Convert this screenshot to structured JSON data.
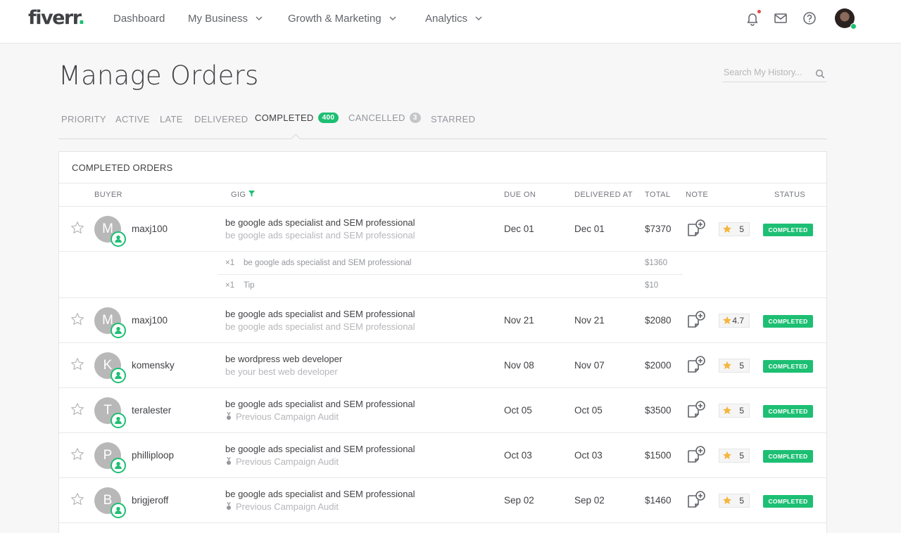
{
  "header": {
    "logo": "fiverr",
    "logo_dot": ".",
    "nav": [
      {
        "label": "Dashboard",
        "has_chevron": false
      },
      {
        "label": "My Business",
        "has_chevron": true
      },
      {
        "label": "Growth & Marketing",
        "has_chevron": true
      },
      {
        "label": "Analytics",
        "has_chevron": true
      }
    ],
    "icons": [
      "bell-icon",
      "envelope-icon",
      "help-icon"
    ],
    "notification_dot_color": "#e34d4d"
  },
  "page": {
    "title": "Manage Orders",
    "search_placeholder": "Search My History..."
  },
  "tabs": [
    {
      "label": "PRIORITY"
    },
    {
      "label": "ACTIVE"
    },
    {
      "label": "LATE"
    },
    {
      "label": "DELIVERED"
    },
    {
      "label": "COMPLETED",
      "badge": "400",
      "active": true
    },
    {
      "label": "CANCELLED",
      "badge": "3"
    },
    {
      "label": "STARRED"
    }
  ],
  "table": {
    "title": "COMPLETED ORDERS",
    "columns": {
      "buyer": "BUYER",
      "gig": "GIG",
      "due_on": "DUE ON",
      "delivered_at": "DELIVERED AT",
      "total": "TOTAL",
      "note": "NOTE",
      "status": "STATUS"
    },
    "rows": [
      {
        "initial": "M",
        "buyer": "maxj100",
        "gig": "be google ads specialist and SEM professional",
        "gig_sub": "be google ads specialist and SEM professional",
        "due": "Dec 01",
        "delivered": "Dec 01",
        "total": "$7370",
        "rating": "5",
        "status": "COMPLETED"
      },
      {
        "initial": "M",
        "buyer": "maxj100",
        "gig": "be google ads specialist and SEM professional",
        "gig_sub": "be google ads specialist and SEM professional",
        "due": "Nov 21",
        "delivered": "Nov 21",
        "total": "$2080",
        "rating": "4.7",
        "status": "COMPLETED"
      },
      {
        "initial": "K",
        "buyer": "komensky",
        "gig": "be wordpress web developer",
        "gig_sub": "be your best web developer",
        "due": "Nov 08",
        "delivered": "Nov 07",
        "total": "$2000",
        "rating": "5",
        "status": "COMPLETED"
      },
      {
        "initial": "T",
        "buyer": "teralester",
        "gig": "be google ads specialist and SEM professional",
        "gig_sub": "Previous Campaign Audit",
        "due": "Oct 05",
        "delivered": "Oct 05",
        "total": "$3500",
        "rating": "5",
        "status": "COMPLETED"
      },
      {
        "initial": "P",
        "buyer": "philliploop",
        "gig": "be google ads specialist and SEM professional",
        "gig_sub": "Previous Campaign Audit",
        "due": "Oct 03",
        "delivered": "Oct 03",
        "total": "$1500",
        "rating": "5",
        "status": "COMPLETED"
      },
      {
        "initial": "B",
        "buyer": "brigjeroff",
        "gig": "be google ads specialist and SEM professional",
        "gig_sub": "Previous Campaign Audit",
        "due": "Sep 02",
        "delivered": "Sep 02",
        "total": "$1460",
        "rating": "5",
        "status": "COMPLETED"
      }
    ],
    "extras": [
      {
        "qty": "×1",
        "desc": "be google ads specialist and SEM professional",
        "amount": "$1360"
      },
      {
        "qty": "×1",
        "desc": "Tip",
        "amount": "$10"
      }
    ]
  },
  "colors": {
    "accent_green": "#1dbf73",
    "text_dark": "#404145",
    "text_muted": "#95979d"
  }
}
